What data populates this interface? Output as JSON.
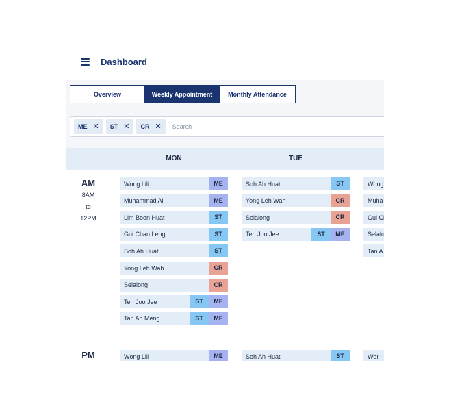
{
  "header": {
    "title": "Dashboard"
  },
  "tabs": [
    {
      "label": "Overview",
      "active": false
    },
    {
      "label": "Weekly Appointment",
      "active": true
    },
    {
      "label": "Monthly Attendance",
      "active": false
    }
  ],
  "filters": {
    "chips": [
      {
        "label": "ME"
      },
      {
        "label": "ST"
      },
      {
        "label": "CR"
      }
    ],
    "search_placeholder": "Search"
  },
  "days": [
    "MON",
    "TUE"
  ],
  "slots": {
    "am": {
      "label": "AM",
      "start": "8AM",
      "to": "to",
      "end": "12PM"
    },
    "pm": {
      "label": "PM"
    }
  },
  "tag_colors": {
    "ME": "#a7b2f0",
    "ST": "#86c7f3",
    "CR": "#e8a395"
  },
  "schedule": {
    "am": {
      "mon": [
        {
          "name": "Wong Lili",
          "tags": [
            "ME"
          ]
        },
        {
          "name": "Muhammad Ali",
          "tags": [
            "ME"
          ]
        },
        {
          "name": "Lim Boon Huat",
          "tags": [
            "ST"
          ]
        },
        {
          "name": "Gui Chan Leng",
          "tags": [
            "ST"
          ]
        },
        {
          "name": "Soh Ah Huat",
          "tags": [
            "ST"
          ]
        },
        {
          "name": "Yong Leh Wah",
          "tags": [
            "CR"
          ]
        },
        {
          "name": "Selalong",
          "tags": [
            "CR"
          ]
        },
        {
          "name": "Teh Joo Jee",
          "tags": [
            "ST",
            "ME"
          ]
        },
        {
          "name": "Tan Ah Meng",
          "tags": [
            "ST",
            "ME"
          ]
        }
      ],
      "tue": [
        {
          "name": "Soh Ah Huat",
          "tags": [
            "ST"
          ]
        },
        {
          "name": "Yong Leh Wah",
          "tags": [
            "CR"
          ]
        },
        {
          "name": "Selalong",
          "tags": [
            "CR"
          ]
        },
        {
          "name": "Teh Joo Jee",
          "tags": [
            "ST",
            "ME"
          ]
        }
      ],
      "wed": [
        {
          "name": "Wong",
          "tags": []
        },
        {
          "name": "Muha",
          "tags": []
        },
        {
          "name": "Gui Ch",
          "tags": []
        },
        {
          "name": "Selalo",
          "tags": []
        },
        {
          "name": "Tan A",
          "tags": []
        }
      ]
    },
    "pm": {
      "mon": [
        {
          "name": "Wong Lili",
          "tags": [
            "ME"
          ]
        }
      ],
      "tue": [
        {
          "name": "Soh Ah Huat",
          "tags": [
            "ST"
          ]
        }
      ],
      "wed": [
        {
          "name": "Wor",
          "tags": []
        }
      ]
    }
  }
}
